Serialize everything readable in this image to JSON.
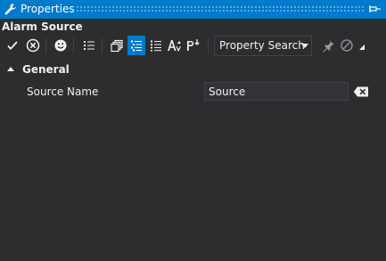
{
  "window": {
    "title": "Properties",
    "pin_icon": "pin-icon",
    "title_icon": "wrench-icon"
  },
  "object": {
    "name": "Alarm Source"
  },
  "toolbar": {
    "buttons": [
      {
        "icon": "checkmark-icon",
        "active": false
      },
      {
        "icon": "cancel-circle-icon",
        "active": false
      },
      {
        "icon": "smiley-icon",
        "active": false
      },
      {
        "icon": "list-icon",
        "active": false
      },
      {
        "icon": "property-pages-icon",
        "active": false
      },
      {
        "icon": "categorized-icon",
        "active": true
      },
      {
        "icon": "alphabetical-list-icon",
        "active": false
      },
      {
        "icon": "font-size-icon",
        "active": false
      },
      {
        "icon": "property-sort-icon",
        "active": false
      }
    ],
    "search": {
      "label": "Property Search"
    },
    "right_icons": [
      "pushpin-icon",
      "no-entry-icon",
      "resize-grip-icon"
    ]
  },
  "grid": {
    "categories": [
      {
        "label": "General",
        "expanded": true,
        "properties": [
          {
            "name": "Source Name",
            "value": "Source"
          }
        ]
      }
    ]
  },
  "colors": {
    "accent": "#007acc",
    "background": "#2d2d30",
    "text": "#f1f1f1"
  }
}
